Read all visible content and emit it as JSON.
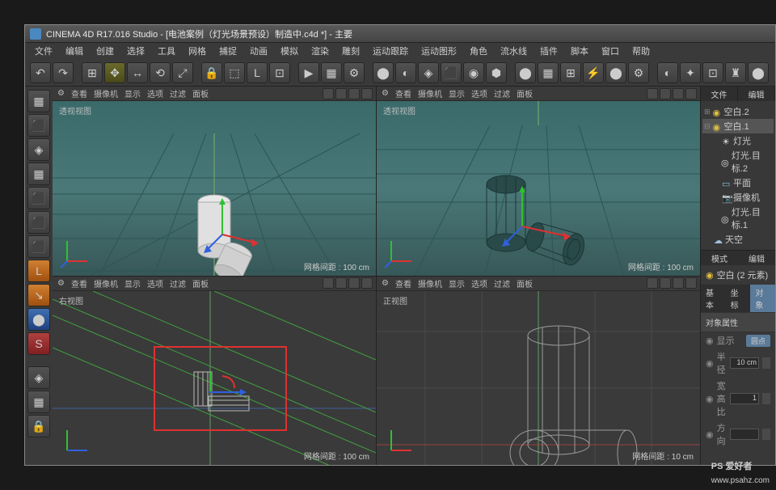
{
  "title": "CINEMA 4D R17.016 Studio - [电池案例（灯光场景预设）制造中.c4d *] - 主要",
  "menu": [
    "文件",
    "编辑",
    "创建",
    "选择",
    "工具",
    "网格",
    "捕捉",
    "动画",
    "模拟",
    "渲染",
    "雕刻",
    "运动跟踪",
    "运动图形",
    "角色",
    "流水线",
    "插件",
    "脚本",
    "窗口",
    "帮助"
  ],
  "toolbar_icons": [
    "↶",
    "↷",
    "",
    "⊞",
    "✥",
    "↔",
    "⟲",
    "⤢",
    "",
    "🔒",
    "⬚",
    "L",
    "⊡",
    "",
    "▶",
    "▦",
    "⚙",
    "",
    "⬤",
    "◐",
    "◈",
    "⬛",
    "◉",
    "⬢",
    "",
    "⬤",
    "▦",
    "⊞",
    "⚡",
    "⬤",
    "⚙",
    "",
    "◐",
    "✦",
    "⊡",
    "♜",
    "⬤"
  ],
  "lefttool_icons": [
    {
      "g": "▦",
      "cls": ""
    },
    {
      "g": "⬛",
      "cls": ""
    },
    {
      "g": "◈",
      "cls": ""
    },
    {
      "g": "▦",
      "cls": ""
    },
    {
      "g": "⬛",
      "cls": ""
    },
    {
      "g": "⬛",
      "cls": ""
    },
    {
      "g": "⬛",
      "cls": ""
    },
    {
      "g": "L",
      "cls": "orange"
    },
    {
      "g": "↘",
      "cls": "orange"
    },
    {
      "g": "⬤",
      "cls": "blue"
    },
    {
      "g": "S",
      "cls": "red"
    },
    {
      "g": "◈",
      "cls": ""
    },
    {
      "g": "▦",
      "cls": ""
    },
    {
      "g": "🔒",
      "cls": ""
    }
  ],
  "vp_menu": [
    "查看",
    "摄像机",
    "显示",
    "选项",
    "过滤",
    "面板"
  ],
  "vp_labels": {
    "tl": "透视视图",
    "tr": "透视视图",
    "bl": "右视图",
    "br": "正视图"
  },
  "hud": "网格间距 : 100 cm",
  "hud_br": "网格间距 : 10 cm",
  "right_tabs_top": [
    "文件",
    "编辑"
  ],
  "objects": [
    {
      "indent": 0,
      "icon": "◉",
      "color": "#e0c040",
      "label": "空白.2",
      "sel": false,
      "exp": "⊞"
    },
    {
      "indent": 0,
      "icon": "◉",
      "color": "#e0c040",
      "label": "空白.1",
      "sel": true,
      "exp": "⊟"
    },
    {
      "indent": 1,
      "icon": "☀",
      "color": "#e0e0e0",
      "label": "灯光",
      "sel": false,
      "exp": ""
    },
    {
      "indent": 1,
      "icon": "◎",
      "color": "#e0e0e0",
      "label": "灯光.目标.2",
      "sel": false,
      "exp": ""
    },
    {
      "indent": 1,
      "icon": "▭",
      "color": "#80c0e0",
      "label": "平面",
      "sel": false,
      "exp": ""
    },
    {
      "indent": 1,
      "icon": "📷",
      "color": "#a0a0a0",
      "label": "摄像机",
      "sel": false,
      "exp": ""
    },
    {
      "indent": 1,
      "icon": "◎",
      "color": "#e0e0e0",
      "label": "灯光.目标.1",
      "sel": false,
      "exp": ""
    },
    {
      "indent": 0,
      "icon": "☁",
      "color": "#a0c0e0",
      "label": "天空",
      "sel": false,
      "exp": ""
    }
  ],
  "attr_tabs_mode": [
    "模式",
    "编辑"
  ],
  "attr_title": "空白 (2 元素)",
  "attr_sub_tabs": [
    "基本",
    "坐标",
    "对象"
  ],
  "attr_section": "对象属性",
  "attr_rows": [
    {
      "label": "显示",
      "type": "badge",
      "value": "圆点"
    },
    {
      "label": "半径",
      "type": "num",
      "value": "10 cm"
    },
    {
      "label": "宽高比",
      "type": "num",
      "value": "1"
    },
    {
      "label": "方向",
      "type": "num",
      "value": ""
    }
  ],
  "watermark": {
    "main": "PS 爱好者",
    "sub": "www.psahz.com"
  }
}
